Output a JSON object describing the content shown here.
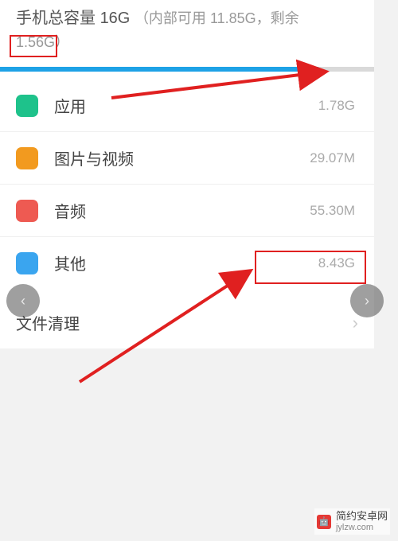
{
  "header": {
    "title_prefix": "手机总容量",
    "capacity": "16G",
    "detail": "（内部可用 11.85G，剩余",
    "remaining": "1.56G）",
    "progress_percent": 85
  },
  "categories": [
    {
      "label": "应用",
      "value": "1.78G",
      "color": "#1ec28b"
    },
    {
      "label": "图片与视频",
      "value": "29.07M",
      "color": "#f29a1f"
    },
    {
      "label": "音频",
      "value": "55.30M",
      "color": "#ee5a52"
    },
    {
      "label": "其他",
      "value": "8.43G",
      "color": "#3aa5ef"
    }
  ],
  "cleanup": {
    "label": "文件清理"
  },
  "watermark": {
    "name": "简约安卓网",
    "site": "jylzw.com"
  },
  "colors": {
    "annotation_red": "#e02020",
    "progress_blue": "#1ea2e6"
  }
}
